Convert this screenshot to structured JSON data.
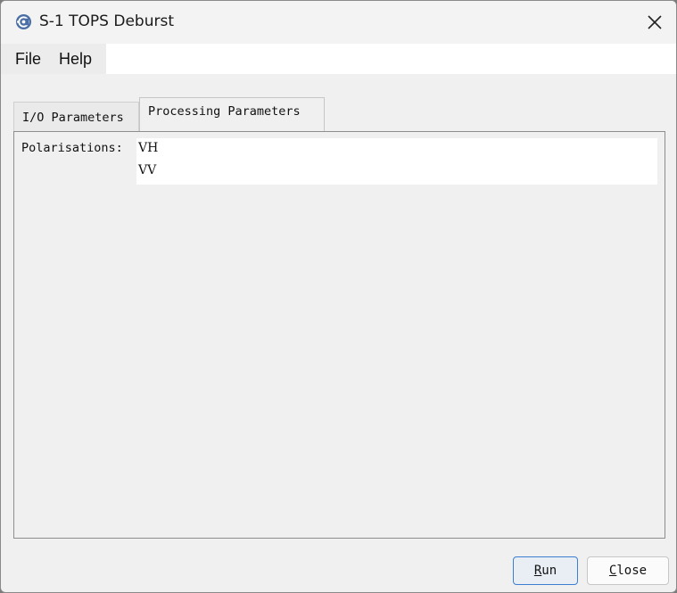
{
  "window": {
    "title": "S-1 TOPS Deburst"
  },
  "menu": {
    "items": [
      "File",
      "Help"
    ]
  },
  "tabs": [
    {
      "label": "I/O Parameters",
      "active": false
    },
    {
      "label": "Processing Parameters",
      "active": true
    }
  ],
  "processing": {
    "polarisations_label": "Polarisations:",
    "polarisations": [
      "VH",
      "VV"
    ]
  },
  "buttons": {
    "run": {
      "mnemonic": "R",
      "rest": "un"
    },
    "close": {
      "mnemonic": "C",
      "rest": "lose"
    }
  },
  "colors": {
    "accent": "#3c7fd1",
    "window_bg": "#f0f0f0"
  },
  "icons": {
    "app": "satellite-app-icon",
    "close": "close-icon"
  }
}
